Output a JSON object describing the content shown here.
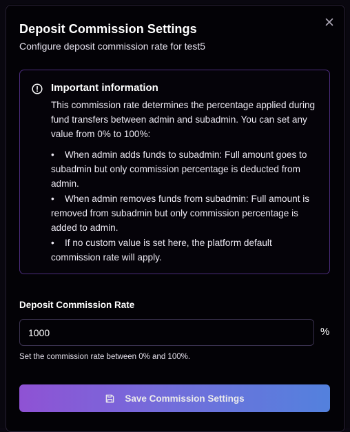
{
  "dialog": {
    "title": "Deposit Commission Settings",
    "subtitle": "Configure deposit commission rate for test5",
    "close_icon": "close-icon"
  },
  "info": {
    "icon": "alert-circle-icon",
    "title": "Important information",
    "intro": "This commission rate determines the percentage applied during fund transfers between admin and subadmin. You can set any value from 0% to 100%:",
    "bullets": [
      "When admin adds funds to subadmin: Full amount goes to subadmin but only commission percentage is deducted from admin.",
      "When admin removes funds from subadmin: Full amount is removed from subadmin but only commission percentage is added to admin.",
      "If no custom value is set here, the platform default commission rate will apply."
    ]
  },
  "form": {
    "label": "Deposit Commission Rate",
    "value": "1000",
    "unit": "%",
    "hint": "Set the commission rate between 0% and 100%."
  },
  "actions": {
    "save_label": "Save Commission Settings",
    "save_icon": "save-icon"
  },
  "colors": {
    "accent_start": "#9b59e6",
    "accent_end": "#5a8cf0",
    "info_border": "#4c2c7d"
  }
}
